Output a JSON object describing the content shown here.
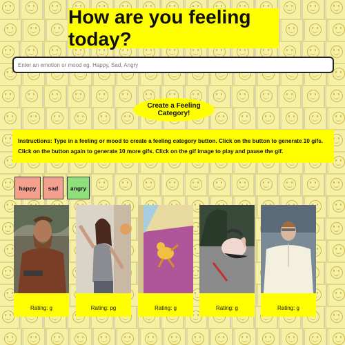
{
  "page": {
    "title": "How are you feeling today?",
    "search_placeholder": "Enter an emotion or mood eg. Happy, Sad, Angry",
    "create_button_label": "Create a Feeling Category!",
    "instructions": "Instructions: Type in a feeling or mood to create a feeling category button. Click on the button to generate 10 gifs. Click on the button again to generate 10 more gifs. Click on the gif image to play and pause the gif."
  },
  "feelings": [
    {
      "label": "happy",
      "color": "#f4a08e"
    },
    {
      "label": "sad",
      "color": "#f4a08e"
    },
    {
      "label": "angry",
      "color": "#8fe07a"
    }
  ],
  "gifs": [
    {
      "rating": "Rating: g",
      "depicts": "bearded man in wilderness"
    },
    {
      "rating": "Rating: pg",
      "depicts": "woman dancing"
    },
    {
      "rating": "Rating: g",
      "depicts": "cartoon creature on purple"
    },
    {
      "rating": "Rating: g",
      "depicts": "pig in costume"
    },
    {
      "rating": "Rating: g",
      "depicts": "man nodding"
    }
  ],
  "colors": {
    "accent_yellow": "#ffff00",
    "note_yellow": "#f6f0a6"
  }
}
